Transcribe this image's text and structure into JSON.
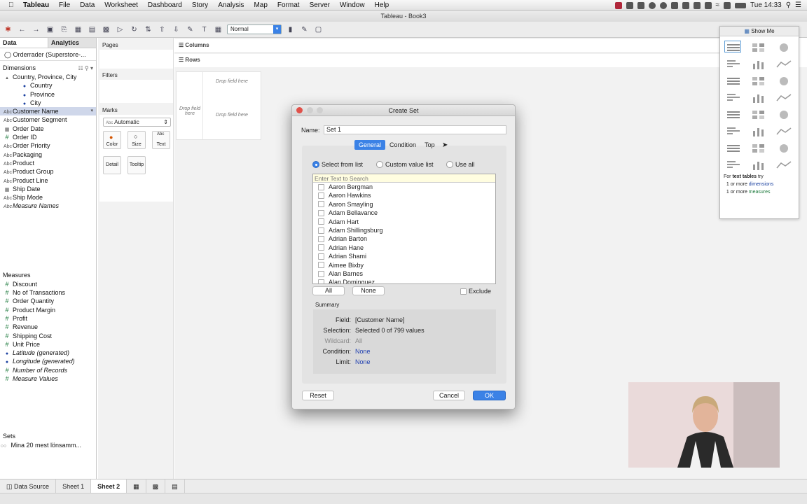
{
  "menubar": {
    "app": "Tableau",
    "items": [
      "File",
      "Data",
      "Worksheet",
      "Dashboard",
      "Story",
      "Analysis",
      "Map",
      "Format",
      "Server",
      "Window",
      "Help"
    ],
    "clock": "Tue 14:33"
  },
  "window": {
    "title": "Tableau - Book3"
  },
  "toolbar": {
    "mark_size_select": "Normal"
  },
  "left": {
    "tab_data": "Data",
    "tab_analytics": "Analytics",
    "datasource": "Orderrader (Superstore-...",
    "dimensions_title": "Dimensions",
    "dimensions": [
      {
        "icon": "hierarchy",
        "label": "Country, Province, City"
      },
      {
        "icon": "globe",
        "label": "Country",
        "indent": true
      },
      {
        "icon": "globe",
        "label": "Province",
        "indent": true
      },
      {
        "icon": "globe",
        "label": "City",
        "indent": true
      },
      {
        "icon": "Abc",
        "label": "Customer Name",
        "selected": true
      },
      {
        "icon": "Abc",
        "label": "Customer Segment"
      },
      {
        "icon": "date",
        "label": "Order Date"
      },
      {
        "icon": "#",
        "label": "Order ID"
      },
      {
        "icon": "Abc",
        "label": "Order Priority"
      },
      {
        "icon": "Abc",
        "label": "Packaging"
      },
      {
        "icon": "Abc",
        "label": "Product"
      },
      {
        "icon": "Abc",
        "label": "Product Group"
      },
      {
        "icon": "Abc",
        "label": "Product Line"
      },
      {
        "icon": "date",
        "label": "Ship Date"
      },
      {
        "icon": "Abc",
        "label": "Ship Mode"
      },
      {
        "icon": "Abc",
        "label": "Measure Names",
        "italic": true
      }
    ],
    "measures_title": "Measures",
    "measures": [
      {
        "icon": "#",
        "label": "Discount"
      },
      {
        "icon": "#",
        "label": "No of Transactions"
      },
      {
        "icon": "#",
        "label": "Order Quantity"
      },
      {
        "icon": "#",
        "label": "Product Margin"
      },
      {
        "icon": "#",
        "label": "Profit"
      },
      {
        "icon": "#",
        "label": "Revenue"
      },
      {
        "icon": "#",
        "label": "Shipping Cost"
      },
      {
        "icon": "#",
        "label": "Unit Price"
      },
      {
        "icon": "globe",
        "label": "Latitude (generated)",
        "italic": true
      },
      {
        "icon": "globe",
        "label": "Longitude (generated)",
        "italic": true
      },
      {
        "icon": "#",
        "label": "Number of Records",
        "italic": true
      },
      {
        "icon": "#",
        "label": "Measure Values",
        "italic": true
      }
    ],
    "sets_title": "Sets",
    "sets": [
      "Mina 20 mest lönsamm..."
    ]
  },
  "cards": {
    "pages": "Pages",
    "filters": "Filters",
    "marks": "Marks",
    "mark_type": "Automatic",
    "buttons": {
      "color": "Color",
      "size": "Size",
      "text": "Text",
      "detail": "Detail",
      "tooltip": "Tooltip"
    }
  },
  "shelves": {
    "columns": "Columns",
    "rows": "Rows"
  },
  "viz": {
    "drop_field": "Drop field here",
    "drop_field_left": "Drop field here"
  },
  "showme": {
    "title": "Show Me",
    "note_prefix": "For ",
    "note_chart": "text tables",
    "note_suffix": " try",
    "line1_num": "1 or more ",
    "line1_word": "dimensions",
    "line2_num": "1 or more ",
    "line2_word": "measures"
  },
  "dialog": {
    "title": "Create Set",
    "name_label": "Name:",
    "name_value": "Set 1",
    "tabs": [
      "General",
      "Condition",
      "Top"
    ],
    "radio_select": "Select from list",
    "radio_custom": "Custom value list",
    "radio_all": "Use all",
    "search_placeholder": "Enter Text to Search",
    "values": [
      "Aaron Bergman",
      "Aaron Hawkins",
      "Aaron Smayling",
      "Adam Bellavance",
      "Adam Hart",
      "Adam Shillingsburg",
      "Adrian Barton",
      "Adrian Hane",
      "Adrian Shami",
      "Aimee Bixby",
      "Alan Barnes",
      "Alan Dominguez"
    ],
    "btn_all": "All",
    "btn_none": "None",
    "exclude": "Exclude",
    "summary_title": "Summary",
    "summary": {
      "field_k": "Field:",
      "field_v": "[Customer Name]",
      "selection_k": "Selection:",
      "selection_v": "Selected 0 of 799 values",
      "wildcard_k": "Wildcard:",
      "wildcard_v": "All",
      "condition_k": "Condition:",
      "condition_v": "None",
      "limit_k": "Limit:",
      "limit_v": "None"
    },
    "reset": "Reset",
    "cancel": "Cancel",
    "ok": "OK"
  },
  "bottom": {
    "data_source": "Data Source",
    "sheet1": "Sheet 1",
    "sheet2": "Sheet 2"
  }
}
